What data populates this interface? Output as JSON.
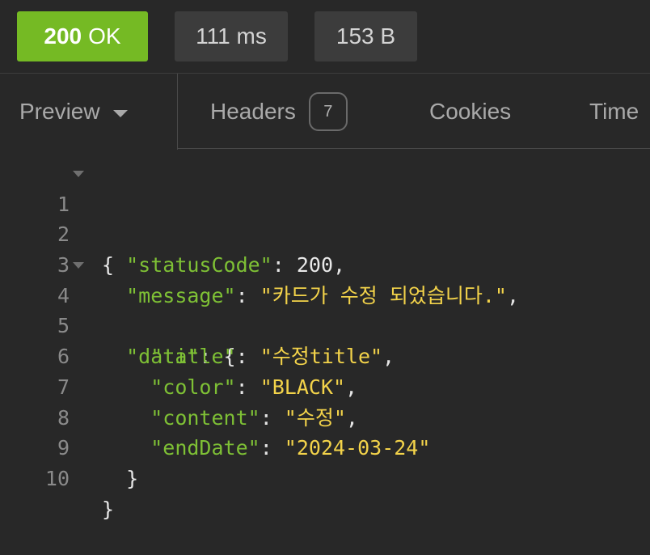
{
  "response": {
    "status_code": "200",
    "status_text": "OK",
    "time": "111 ms",
    "size": "153 B"
  },
  "tabs": {
    "preview": "Preview",
    "headers": "Headers",
    "headers_count": "7",
    "cookies": "Cookies",
    "timeline": "Time"
  },
  "body": {
    "lines": [
      {
        "n": "1"
      },
      {
        "n": "2"
      },
      {
        "n": "3"
      },
      {
        "n": "4"
      },
      {
        "n": "5"
      },
      {
        "n": "6"
      },
      {
        "n": "7"
      },
      {
        "n": "8"
      },
      {
        "n": "9"
      },
      {
        "n": "10"
      }
    ],
    "keys": {
      "statusCode": "\"statusCode\"",
      "message": "\"message\"",
      "data": "\"data\"",
      "title": "\"title\"",
      "color": "\"color\"",
      "content": "\"content\"",
      "endDate": "\"endDate\""
    },
    "values": {
      "statusCode": "200",
      "message": "\"카드가 수정 되었습니다.\"",
      "title": "\"수정title\"",
      "color": "\"BLACK\"",
      "content": "\"수정\"",
      "endDate": "\"2024-03-24\""
    }
  },
  "colors": {
    "status_ok": "#75ba24",
    "json_key": "#7ec035",
    "json_string": "#f3d34a",
    "background": "#282828"
  }
}
